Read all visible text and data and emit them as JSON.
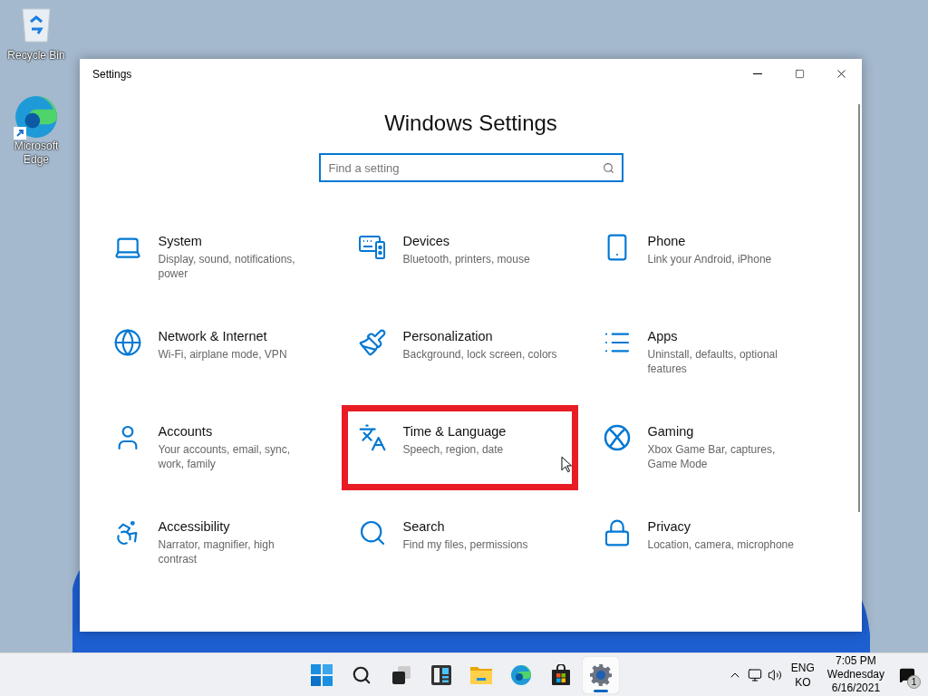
{
  "desktop_icons": [
    {
      "label": "Recycle Bin"
    },
    {
      "label": "Microsoft Edge",
      "shortcut": true
    }
  ],
  "window": {
    "title": "Settings",
    "heading": "Windows Settings",
    "search": {
      "placeholder": "Find a setting"
    },
    "categories": [
      {
        "title": "System",
        "description": "Display, sound, notifications, power",
        "highlighted": false
      },
      {
        "title": "Devices",
        "description": "Bluetooth, printers, mouse",
        "highlighted": false
      },
      {
        "title": "Phone",
        "description": "Link your Android, iPhone",
        "highlighted": false
      },
      {
        "title": "Network & Internet",
        "description": "Wi-Fi, airplane mode, VPN",
        "highlighted": false
      },
      {
        "title": "Personalization",
        "description": "Background, lock screen, colors",
        "highlighted": false
      },
      {
        "title": "Apps",
        "description": "Uninstall, defaults, optional features",
        "highlighted": false
      },
      {
        "title": "Accounts",
        "description": "Your accounts, email, sync, work, family",
        "highlighted": false
      },
      {
        "title": "Time & Language",
        "description": "Speech, region, date",
        "highlighted": true
      },
      {
        "title": "Gaming",
        "description": "Xbox Game Bar, captures, Game Mode",
        "highlighted": false
      },
      {
        "title": "Accessibility",
        "description": "Narrator, magnifier, high contrast",
        "highlighted": false
      },
      {
        "title": "Search",
        "description": "Find my files, permissions",
        "highlighted": false
      },
      {
        "title": "Privacy",
        "description": "Location, camera, microphone",
        "highlighted": false
      }
    ]
  },
  "taskbar": {
    "apps": [
      {
        "kind": "start",
        "selected": false
      },
      {
        "kind": "search",
        "selected": false
      },
      {
        "kind": "taskview",
        "selected": false
      },
      {
        "kind": "widgets",
        "selected": false
      },
      {
        "kind": "explorer",
        "selected": false
      },
      {
        "kind": "edge",
        "selected": false
      },
      {
        "kind": "store",
        "selected": false
      },
      {
        "kind": "settings",
        "selected": true
      }
    ],
    "language": "ENG",
    "layout": "KO",
    "time": "7:05 PM",
    "day": "Wednesday",
    "date": "6/16/2021",
    "notification_count": "1"
  }
}
